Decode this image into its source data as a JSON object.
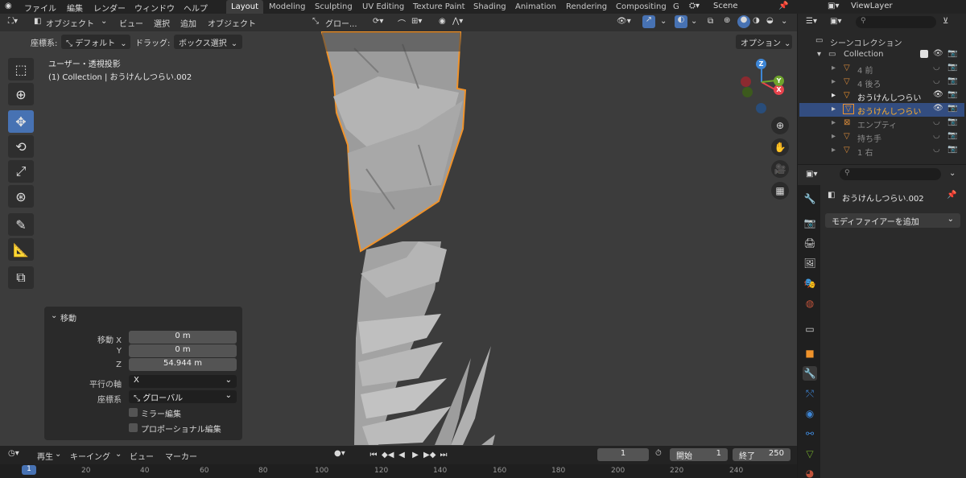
{
  "topbar": {
    "menus": [
      "ファイル",
      "編集",
      "レンダー",
      "ウィンドウ",
      "ヘルプ"
    ],
    "workspaces": [
      "Layout",
      "Modeling",
      "Sculpting",
      "UV Editing",
      "Texture Paint",
      "Shading",
      "Animation",
      "Rendering",
      "Compositing",
      "G"
    ],
    "scene": "Scene",
    "view_layer": "ViewLayer"
  },
  "viewport_header": {
    "mode": "オブジェクト",
    "menus": [
      "ビュー",
      "選択",
      "追加",
      "オブジェクト"
    ],
    "orientation": "グロー...",
    "coord_label": "座標系:",
    "coord_value": "デフォルト",
    "drag_label": "ドラッグ:",
    "drag_value": "ボックス選択",
    "options": "オプション"
  },
  "overlay_text": {
    "view_name": "ユーザー・透視投影",
    "context": "(1) Collection | おうけんしつらい.002"
  },
  "gizmo": {
    "x": "X",
    "y": "Y",
    "z": "Z"
  },
  "operator_panel": {
    "title": "移動",
    "fields": [
      {
        "label": "移動 X",
        "value": "0 m"
      },
      {
        "label": "Y",
        "value": "0 m"
      },
      {
        "label": "Z",
        "value": "54.944 m"
      }
    ],
    "axis_label": "平行の軸",
    "axis_value": "X",
    "orient_label": "座標系",
    "orient_value": "グローバル",
    "mirror_label": "ミラー編集",
    "proportional_label": "プロポーショナル編集"
  },
  "outliner": {
    "title": "シーンコレクション",
    "collection": "Collection",
    "items": [
      "4 前",
      "4 後ろ",
      "おうけんしつらい",
      "おうけんしつらい",
      "エンプティ",
      "持ち手",
      "1 右"
    ]
  },
  "properties": {
    "object_name": "おうけんしつらい.002",
    "add_modifier": "モディファイアーを追加"
  },
  "timeline": {
    "menus": [
      "再生",
      "キーイング",
      "ビュー",
      "マーカー"
    ],
    "current_frame": "1",
    "start_label": "開始",
    "start_value": "1",
    "end_label": "終了",
    "end_value": "250",
    "ruler": [
      "1",
      "20",
      "40",
      "60",
      "80",
      "100",
      "120",
      "140",
      "160",
      "180",
      "200",
      "220",
      "240"
    ]
  },
  "colors": {
    "accent": "#4772b3",
    "selection_outline": "#f0932b",
    "viewport_bg": "#3c3c3c",
    "x_axis": "#e8434d",
    "y_axis": "#6ea42b",
    "z_axis": "#3e86d6"
  }
}
